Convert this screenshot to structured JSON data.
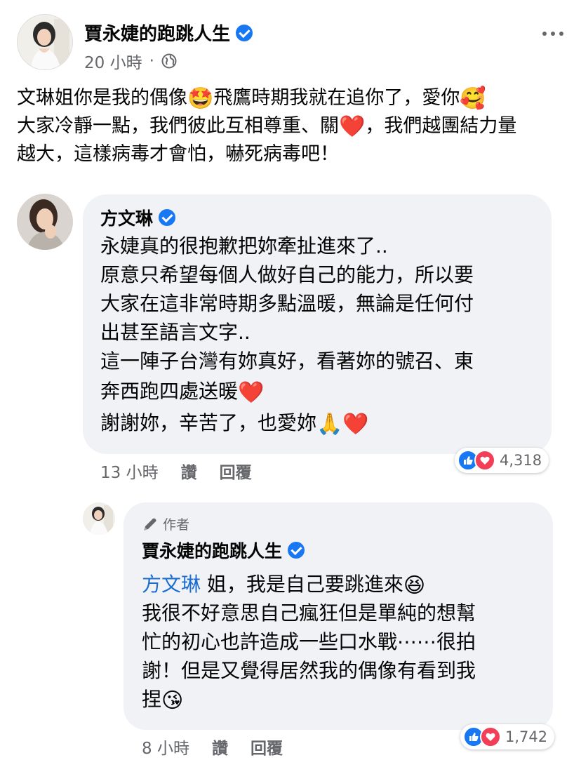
{
  "post": {
    "author": "賈永婕的跑跳人生",
    "time": "20 小時",
    "separator": "·",
    "line1_a": "文琳姐你是我的偶像",
    "line1_emoji1": "🤩",
    "line1_b": "飛鷹時期我就在追你了，愛你",
    "line1_emoji2": "🥰",
    "line2_a": "大家冷靜一點，我們彼此互相尊重、關",
    "line2_heart": "❤️",
    "line2_b": "，我們越團結力量",
    "line3": "越大，這樣病毒才會怕，嚇死病毒吧！"
  },
  "comment": {
    "author": "方文琳",
    "line1": "永婕真的很抱歉把妳牽扯進來了..",
    "line2": "原意只希望每個人做好自己的能力，所以要",
    "line3": "大家在這非常時期多點溫暖，無論是任何付",
    "line4": "出甚至語言文字..",
    "line5": "這一陣子台灣有妳真好，看著妳的號召、東",
    "line6": "奔西跑四處送暖",
    "line6_heart": "❤️",
    "line7": "謝謝妳，辛苦了，也愛妳",
    "line7_emoji": "🙏",
    "line7_heart": "❤️",
    "time": "13 小時",
    "like_action": "讚",
    "reply_action": "回覆",
    "reaction_count": "4,318"
  },
  "reply": {
    "author_tag": "作者",
    "author": "賈永婕的跑跳人生",
    "mention": "方文琳",
    "line1_rest": " 姐，我是自己要跳進來",
    "line1_emoji": "😆",
    "line2": "我很不好意思自己瘋狂但是單純的想幫",
    "line3": "忙的初心也許造成一些口水戰⋯⋯很拍",
    "line4": "謝！但是又覺得居然我的偶像有看到我",
    "line5": "捏",
    "line5_emoji": "😘",
    "time": "8 小時",
    "like_action": "讚",
    "reply_action": "回覆",
    "reaction_count": "1,742"
  },
  "icons": {
    "verified": "verified-badge-icon",
    "globe": "globe-icon",
    "more": "more-options-icon",
    "pen": "pen-icon",
    "like": "like-reaction-icon",
    "love": "love-reaction-icon"
  },
  "colors": {
    "verified": "#1877f2",
    "like": "#1877f2",
    "love": "#f33e58",
    "mention": "#1c6dd0",
    "bubble": "#f0f2f5",
    "meta": "#65676b"
  }
}
